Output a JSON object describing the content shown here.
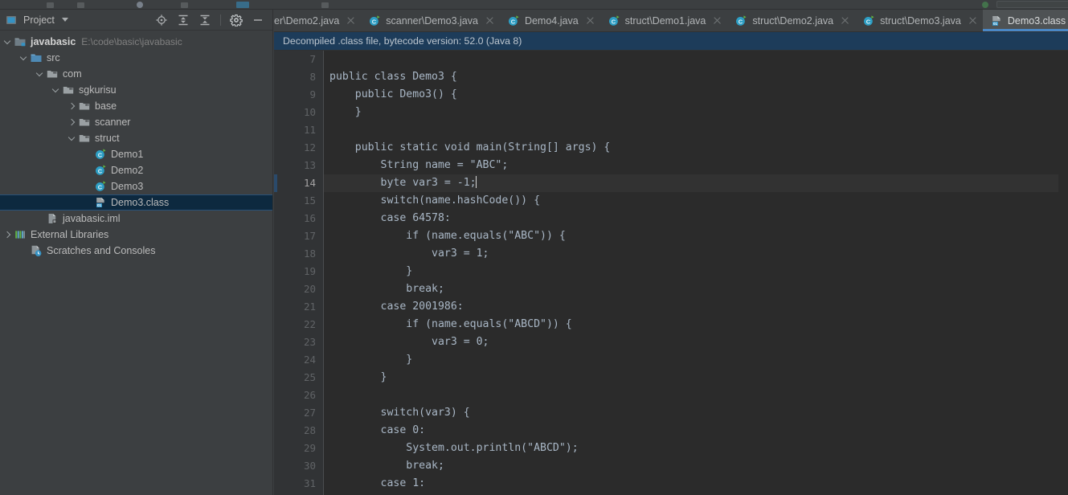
{
  "panel": {
    "title": "Project",
    "actions": [
      {
        "name": "locate-icon",
        "label": "Select Opened File"
      },
      {
        "name": "expand-all-icon",
        "label": "Expand All"
      },
      {
        "name": "collapse-all-icon",
        "label": "Collapse All"
      },
      {
        "name": "gear-icon",
        "label": "Settings"
      },
      {
        "name": "minimize-icon",
        "label": "Hide"
      }
    ]
  },
  "tree": [
    {
      "label": "javabasic",
      "path": "E:\\code\\basic\\javabasic",
      "indent": 0,
      "arrow": "down",
      "icon": "module-folder-icon",
      "bold": true,
      "selected": false
    },
    {
      "label": "src",
      "path": "",
      "indent": 1,
      "arrow": "down",
      "icon": "source-folder-icon",
      "bold": false,
      "selected": false
    },
    {
      "label": "com",
      "path": "",
      "indent": 2,
      "arrow": "down",
      "icon": "package-icon",
      "bold": false,
      "selected": false
    },
    {
      "label": "sgkurisu",
      "path": "",
      "indent": 3,
      "arrow": "down",
      "icon": "package-icon",
      "bold": false,
      "selected": false
    },
    {
      "label": "base",
      "path": "",
      "indent": 4,
      "arrow": "right",
      "icon": "package-icon",
      "bold": false,
      "selected": false
    },
    {
      "label": "scanner",
      "path": "",
      "indent": 4,
      "arrow": "right",
      "icon": "package-icon",
      "bold": false,
      "selected": false
    },
    {
      "label": "struct",
      "path": "",
      "indent": 4,
      "arrow": "down",
      "icon": "package-icon",
      "bold": false,
      "selected": false
    },
    {
      "label": "Demo1",
      "path": "",
      "indent": 5,
      "arrow": "none",
      "icon": "java-class-icon",
      "bold": false,
      "selected": false
    },
    {
      "label": "Demo2",
      "path": "",
      "indent": 5,
      "arrow": "none",
      "icon": "java-class-icon",
      "bold": false,
      "selected": false
    },
    {
      "label": "Demo3",
      "path": "",
      "indent": 5,
      "arrow": "none",
      "icon": "java-class-icon",
      "bold": false,
      "selected": false
    },
    {
      "label": "Demo3.class",
      "path": "",
      "indent": 5,
      "arrow": "none",
      "icon": "compiled-class-icon",
      "bold": false,
      "selected": true
    },
    {
      "label": "javabasic.iml",
      "path": "",
      "indent": 2,
      "arrow": "none",
      "icon": "iml-file-icon",
      "bold": false,
      "selected": false
    },
    {
      "label": "External Libraries",
      "path": "",
      "indent": 0,
      "arrow": "right",
      "icon": "libraries-icon",
      "bold": false,
      "selected": false
    },
    {
      "label": "Scratches and Consoles",
      "path": "",
      "indent": 1,
      "arrow": "none",
      "icon": "scratches-icon",
      "bold": false,
      "selected": false
    }
  ],
  "tabs": [
    {
      "label": "er\\Demo2.java",
      "icon": "java-class-icon",
      "active": false,
      "truncated_left": true
    },
    {
      "label": "scanner\\Demo3.java",
      "icon": "java-class-icon",
      "active": false,
      "truncated_left": false
    },
    {
      "label": "Demo4.java",
      "icon": "java-class-icon",
      "active": false,
      "truncated_left": false
    },
    {
      "label": "struct\\Demo1.java",
      "icon": "java-class-icon",
      "active": false,
      "truncated_left": false
    },
    {
      "label": "struct\\Demo2.java",
      "icon": "java-class-icon",
      "active": false,
      "truncated_left": false
    },
    {
      "label": "struct\\Demo3.java",
      "icon": "java-class-icon",
      "active": false,
      "truncated_left": false
    },
    {
      "label": "Demo3.class",
      "icon": "compiled-class-icon",
      "active": true,
      "truncated_left": false
    }
  ],
  "notification": {
    "text": "Decompiled .class file, bytecode version: 52.0 (Java 8)"
  },
  "editor": {
    "first_line_number": 7,
    "current_line_number": 14,
    "lines": [
      {
        "n": 7,
        "text": ""
      },
      {
        "n": 8,
        "text": "public class Demo3 {"
      },
      {
        "n": 9,
        "text": "    public Demo3() {"
      },
      {
        "n": 10,
        "text": "    }"
      },
      {
        "n": 11,
        "text": ""
      },
      {
        "n": 12,
        "text": "    public static void main(String[] args) {"
      },
      {
        "n": 13,
        "text": "        String name = \"ABC\";"
      },
      {
        "n": 14,
        "text": "        byte var3 = -1;",
        "caret_after": true
      },
      {
        "n": 15,
        "text": "        switch(name.hashCode()) {"
      },
      {
        "n": 16,
        "text": "        case 64578:"
      },
      {
        "n": 17,
        "text": "            if (name.equals(\"ABC\")) {"
      },
      {
        "n": 18,
        "text": "                var3 = 1;"
      },
      {
        "n": 19,
        "text": "            }"
      },
      {
        "n": 20,
        "text": "            break;"
      },
      {
        "n": 21,
        "text": "        case 2001986:"
      },
      {
        "n": 22,
        "text": "            if (name.equals(\"ABCD\")) {"
      },
      {
        "n": 23,
        "text": "                var3 = 0;"
      },
      {
        "n": 24,
        "text": "            }"
      },
      {
        "n": 25,
        "text": "        }"
      },
      {
        "n": 26,
        "text": ""
      },
      {
        "n": 27,
        "text": "        switch(var3) {"
      },
      {
        "n": 28,
        "text": "        case 0:"
      },
      {
        "n": 29,
        "text": "            System.out.println(\"ABCD\");"
      },
      {
        "n": 30,
        "text": "            break;"
      },
      {
        "n": 31,
        "text": "        case 1:"
      }
    ]
  },
  "colors": {
    "panel_bg": "#3c3f41",
    "editor_bg": "#2b2b2b",
    "gutter_bg": "#313335",
    "code_text": "#a9b7c6",
    "selection_bg": "#0d293f",
    "notification_bg": "#1d3c5a",
    "active_tab_bg": "#4e5254",
    "tab_underline": "#4a88c7",
    "current_line_bg": "#323232"
  }
}
